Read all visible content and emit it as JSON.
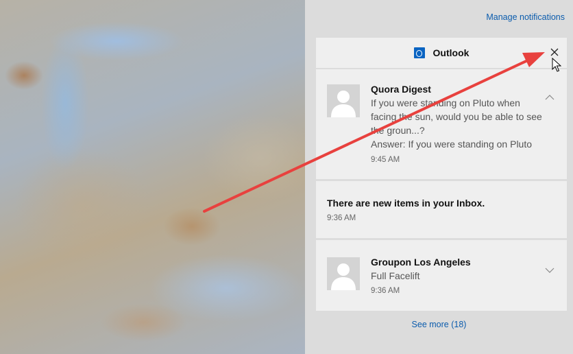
{
  "panel": {
    "manage_label": "Manage notifications",
    "see_more_label": "See more (18)"
  },
  "app_group": {
    "name": "Outlook",
    "icon": "outlook-icon",
    "close_glyph": "✕"
  },
  "notifications": [
    {
      "sender": "Quora Digest",
      "subject": "If you were standing on Pluto when facing the sun, would you be able to see the groun...?",
      "preview": "Answer: If you were standing on Pluto",
      "time": "9:45 AM",
      "expanded": true
    },
    {
      "message": "There are new items in your Inbox.",
      "time": "9:36 AM"
    },
    {
      "sender": "Groupon Los Angeles",
      "subject": "Full Facelift",
      "time": "9:36 AM",
      "expanded": false
    }
  ],
  "colors": {
    "link": "#0b5cad",
    "annotation_arrow": "#e8413e"
  }
}
